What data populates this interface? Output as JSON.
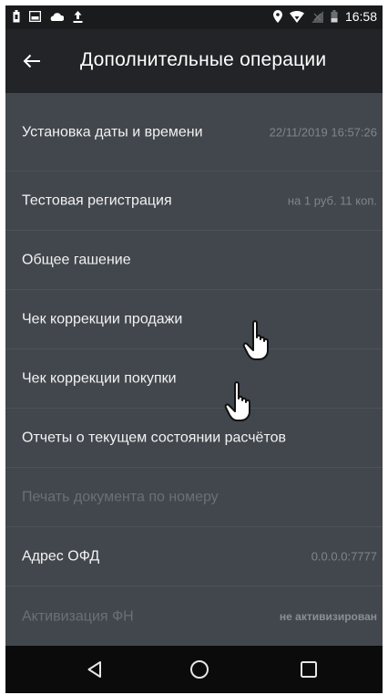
{
  "status_bar": {
    "time": "16:58",
    "left_icons": [
      "battery-saver-icon",
      "image-icon",
      "cloud-icon",
      "upload-icon"
    ],
    "right_icons": [
      "location-pin-icon",
      "wifi-icon",
      "no-signal-icon",
      "battery-icon"
    ]
  },
  "app_bar": {
    "back_icon": "arrow-left-icon",
    "title": "Дополнительные операции"
  },
  "menu": {
    "items": [
      {
        "label": "Установка даты и времени",
        "value": "22/11/2019 16:57:26",
        "enabled": true
      },
      {
        "label": "Тестовая регистрация",
        "value": "на 1 руб. 11 коп.",
        "enabled": true
      },
      {
        "label": "Общее гашение",
        "value": "",
        "enabled": true
      },
      {
        "label": "Чек коррекции продажи",
        "value": "",
        "enabled": true
      },
      {
        "label": "Чек коррекции покупки",
        "value": "",
        "enabled": true
      },
      {
        "label": "Отчеты о текущем состоянии расчётов",
        "value": "",
        "enabled": true
      },
      {
        "label": "Печать документа по номеру",
        "value": "",
        "enabled": false
      },
      {
        "label": "Адрес ОФД",
        "value": "0.0.0.0:7777",
        "enabled": true
      },
      {
        "label": "Активизация ФН",
        "value": "не активизирован",
        "enabled": false
      }
    ]
  },
  "nav_bar": {
    "icons": [
      "back-triangle-icon",
      "home-circle-icon",
      "recents-square-icon"
    ]
  },
  "colors": {
    "background": "#42474d",
    "app_bar": "#222427",
    "status_bar": "#1a1b1d",
    "nav_bar": "#0b0b0c",
    "text_primary": "#f2f2f2",
    "text_disabled": "#6b7076",
    "text_value": "#80858b",
    "divider": "#4d5258"
  }
}
